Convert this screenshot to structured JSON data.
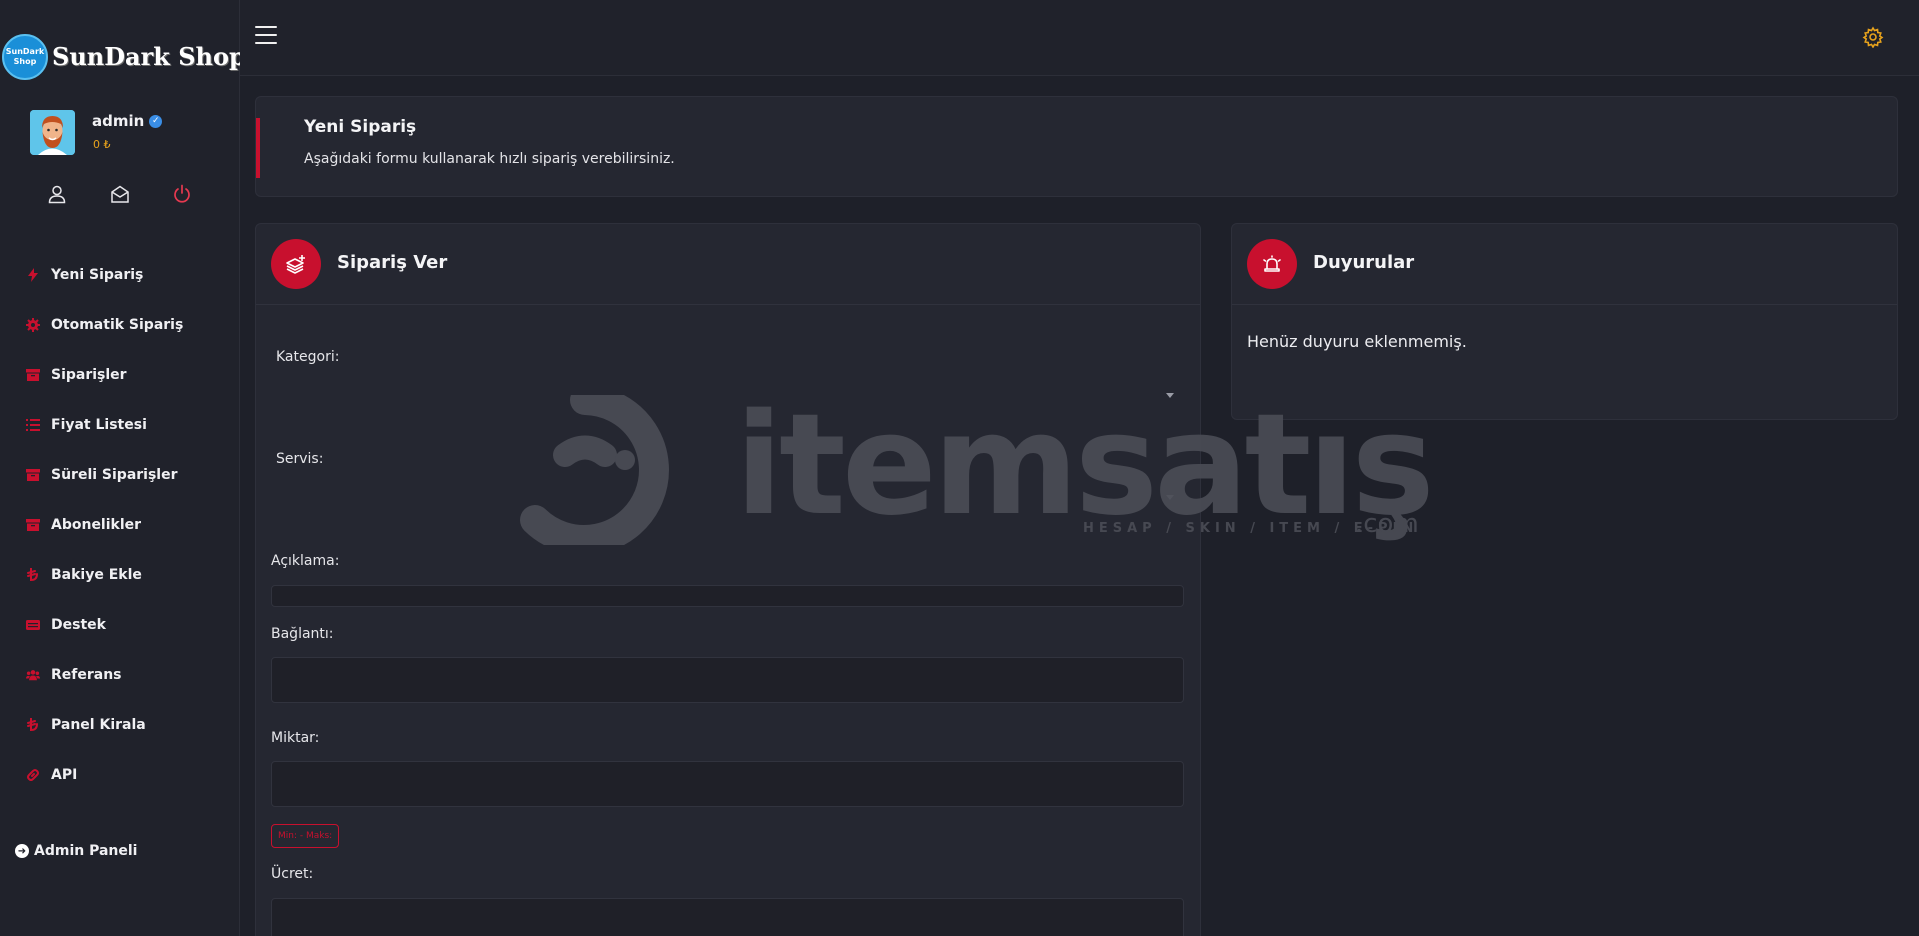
{
  "brand": {
    "logo_text_line1": "SunDark",
    "logo_text_line2": "Shop",
    "name": "SunDark Shop"
  },
  "profile": {
    "username": "admin",
    "balance": "0 ₺"
  },
  "profile_actions": [
    "user-icon",
    "envelope-open-icon",
    "power-icon"
  ],
  "menu": [
    {
      "label": "Yeni Sipariş",
      "icon": "bolt-icon"
    },
    {
      "label": "Otomatik Sipariş",
      "icon": "cog-icon"
    },
    {
      "label": "Siparişler",
      "icon": "archive-icon"
    },
    {
      "label": "Fiyat Listesi",
      "icon": "list-icon"
    },
    {
      "label": "Süreli Siparişler",
      "icon": "archive-icon"
    },
    {
      "label": "Abonelikler",
      "icon": "archive-icon"
    },
    {
      "label": "Bakiye Ekle",
      "icon": "lira-icon"
    },
    {
      "label": "Destek",
      "icon": "ticket-icon"
    },
    {
      "label": "Referans",
      "icon": "users-icon"
    },
    {
      "label": "Panel Kirala",
      "icon": "lira-icon"
    },
    {
      "label": "API",
      "icon": "link-icon"
    }
  ],
  "admin_link": "Admin Paneli",
  "hero": {
    "title": "Yeni Sipariş",
    "subtitle": "Aşağıdaki formu kullanarak hızlı sipariş verebilirsiniz."
  },
  "order_card": {
    "title": "Sipariş Ver",
    "category_label": "Kategori:",
    "service_label": "Servis:",
    "description_label": "Açıklama:",
    "link_label": "Bağlantı:",
    "quantity_label": "Miktar:",
    "minmax": "Min: - Maks:",
    "price_label": "Ücret:"
  },
  "announcements": {
    "title": "Duyurular",
    "empty_text": "Henüz duyuru eklenmemiş."
  },
  "watermark": {
    "brand": "itemsatış",
    "tagline": "HESAP / SKIN / ITEM / E-PIN",
    "suffix": ".com"
  },
  "colors": {
    "accent": "#c8102e",
    "gold": "#e8a31c",
    "background": "#1e2029",
    "panel": "#252731"
  }
}
